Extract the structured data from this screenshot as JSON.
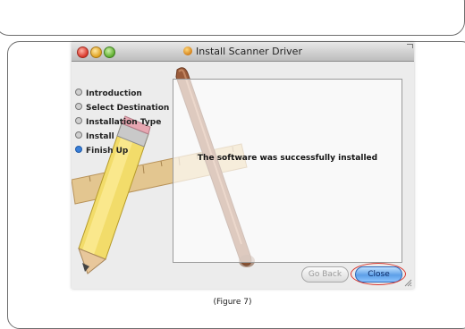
{
  "window": {
    "title": "Install Scanner Driver"
  },
  "steps": [
    {
      "label": "Introduction",
      "current": false
    },
    {
      "label": "Select Destination",
      "current": false
    },
    {
      "label": "Installation Type",
      "current": false
    },
    {
      "label": "Install",
      "current": false
    },
    {
      "label": "Finish Up",
      "current": true
    }
  ],
  "content": {
    "message": "The software was successfully installed"
  },
  "buttons": {
    "go_back": "Go Back",
    "close": "Close"
  },
  "caption": "(Figure 7)",
  "colors": {
    "accent": "#3a7fd8",
    "highlight_ring": "#d8372f"
  },
  "icons": [
    "installer-package-icon",
    "close-window-icon",
    "minimize-window-icon",
    "zoom-window-icon"
  ]
}
